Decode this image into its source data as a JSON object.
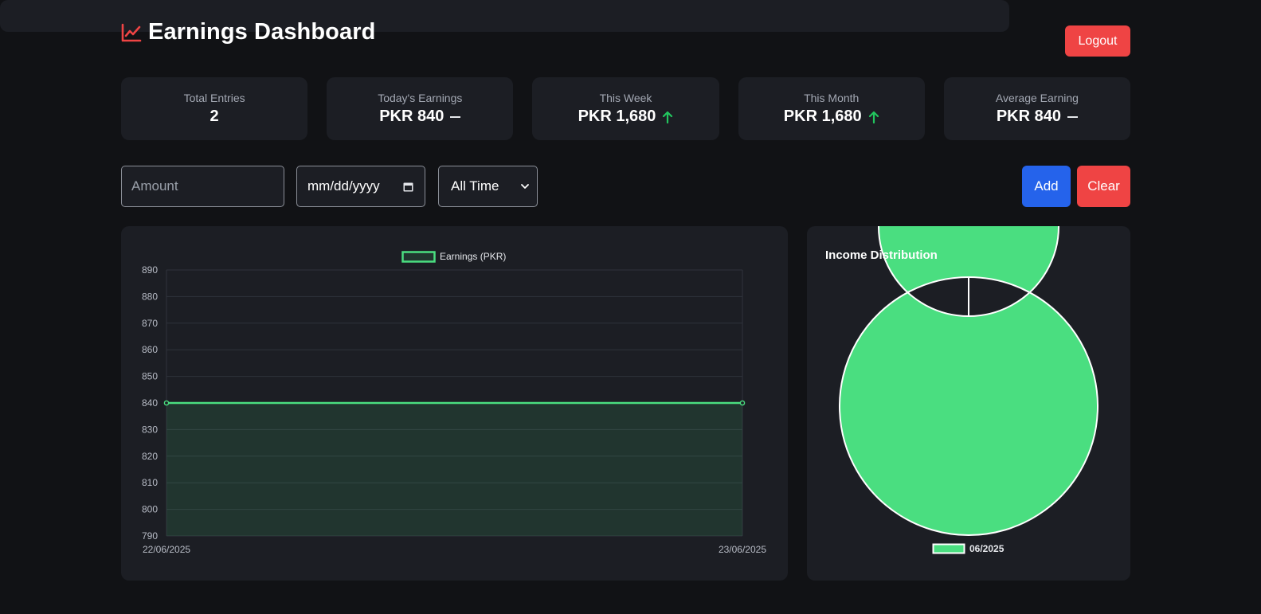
{
  "header": {
    "title": "Earnings Dashboard",
    "title_icon": "chart-line-icon",
    "logout_label": "Logout"
  },
  "stats": [
    {
      "label": "Total Entries",
      "value": "2",
      "trend": "none"
    },
    {
      "label": "Today's Earnings",
      "value": "PKR 840",
      "trend": "flat"
    },
    {
      "label": "This Week",
      "value": "PKR 1,680",
      "trend": "up"
    },
    {
      "label": "This Month",
      "value": "PKR 1,680",
      "trend": "up"
    },
    {
      "label": "Average Earning",
      "value": "PKR 840",
      "trend": "flat"
    }
  ],
  "form": {
    "amount_placeholder": "Amount",
    "date_placeholder": "mm/dd/yyyy",
    "period_selected": "All Time",
    "add_label": "Add",
    "clear_label": "Clear"
  },
  "colors": {
    "accent_red": "#ef4444",
    "accent_blue": "#2563eb",
    "accent_green": "#4ade80",
    "trend_up": "#22c55e"
  },
  "chart_data": [
    {
      "type": "line",
      "x": [
        "22/06/2025",
        "23/06/2025"
      ],
      "series": [
        {
          "name": "Earnings (PKR)",
          "values": [
            840,
            840
          ]
        }
      ],
      "ylim": [
        790,
        890
      ],
      "yticks": [
        790,
        800,
        810,
        820,
        830,
        840,
        850,
        860,
        870,
        880,
        890
      ],
      "fill": true,
      "grid": true,
      "legend": "top-center",
      "title": "",
      "xlabel": "",
      "ylabel": ""
    },
    {
      "type": "pie",
      "title": "Income Distribution",
      "labels": [
        "06/2025"
      ],
      "values": [
        1680
      ],
      "donut": true,
      "legend": "bottom"
    }
  ]
}
